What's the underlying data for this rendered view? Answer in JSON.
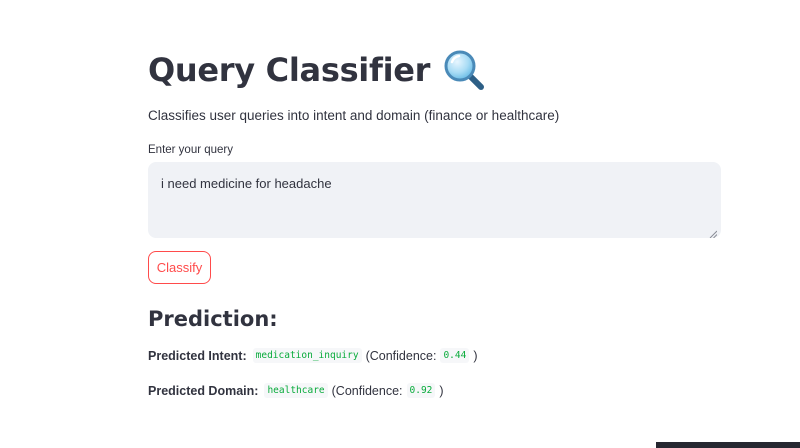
{
  "header": {
    "title": "Query Classifier",
    "title_icon": "magnifying-glass-icon",
    "subtitle": "Classifies user queries into intent and domain (finance or healthcare)"
  },
  "query": {
    "label": "Enter your query",
    "value": "i need medicine for headache"
  },
  "classify_button": {
    "label": "Classify"
  },
  "prediction": {
    "heading": "Prediction:",
    "intent": {
      "label": "Predicted Intent:",
      "value": "medication_inquiry",
      "confidence_open": "(Confidence:",
      "confidence": "0.44",
      "confidence_close": ")"
    },
    "domain": {
      "label": "Predicted Domain:",
      "value": "healthcare",
      "confidence_open": "(Confidence:",
      "confidence": "0.92",
      "confidence_close": ")"
    }
  },
  "colors": {
    "accent": "#ff4b4b",
    "code_text": "#09ab3b",
    "text": "#31333f",
    "input_bg": "#f0f2f6"
  }
}
